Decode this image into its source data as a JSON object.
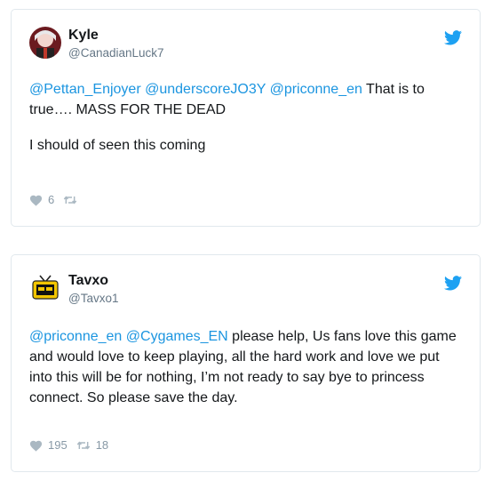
{
  "tweets": [
    {
      "name": "Kyle",
      "handle": "@CanadianLuck7",
      "mentions": [
        "@Pettan_Enjoyer",
        "@underscoreJO3Y",
        "@priconne_en"
      ],
      "text_line1_tail": "That is to true…. MASS FOR THE DEAD",
      "text_para2": "I should of seen this coming",
      "likes": "6",
      "retweets": "",
      "avatar_icon": "anime-character-avatar",
      "colors": {
        "accent": "#1b95e0",
        "heart": "#aab8c2"
      }
    },
    {
      "name": "Tavxo",
      "handle": "@Tavxo1",
      "mentions": [
        "@priconne_en",
        "@Cygames_EN"
      ],
      "text_tail": "please help, Us fans love this game and would love to keep playing, all the hard work and love we put into this will be for nothing, I’m not ready to say bye to princess connect. So please save the day.",
      "likes": "195",
      "retweets": "18",
      "avatar_icon": "tv-logo-avatar"
    }
  ]
}
